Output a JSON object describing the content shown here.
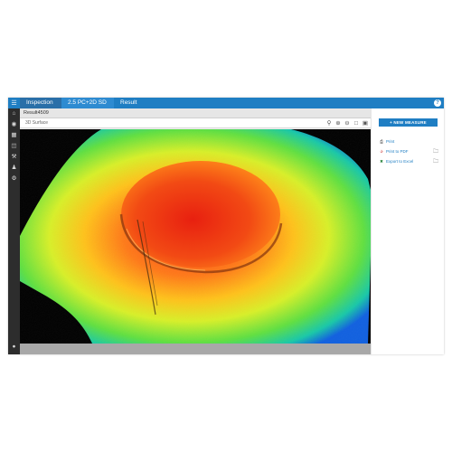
{
  "topbar": {
    "breadcrumbs": [
      "Inspection",
      "2.5 PC+2D SD",
      "Result"
    ],
    "help_icon": "?"
  },
  "sidebar": {
    "icons": [
      "home-icon",
      "globe-icon",
      "book-icon",
      "layers-icon",
      "wrench-icon",
      "users-icon",
      "gear-icon",
      "user-icon"
    ]
  },
  "content": {
    "title": "Result4509",
    "view_label": "3D Surface",
    "tools": [
      "search-icon",
      "zoom-in-icon",
      "zoom-out-icon",
      "fit-icon",
      "image-icon"
    ]
  },
  "right_panel": {
    "new_measure_label": "+ NEW MEASURE",
    "items": [
      {
        "icon": "print-icon",
        "label": "Print"
      },
      {
        "icon": "pdf-icon",
        "label": "Print to PDF"
      },
      {
        "icon": "excel-icon",
        "label": "Export to Excel"
      }
    ]
  },
  "colors": {
    "accent": "#1f7ec3",
    "sidebar": "#2d2d2d"
  }
}
